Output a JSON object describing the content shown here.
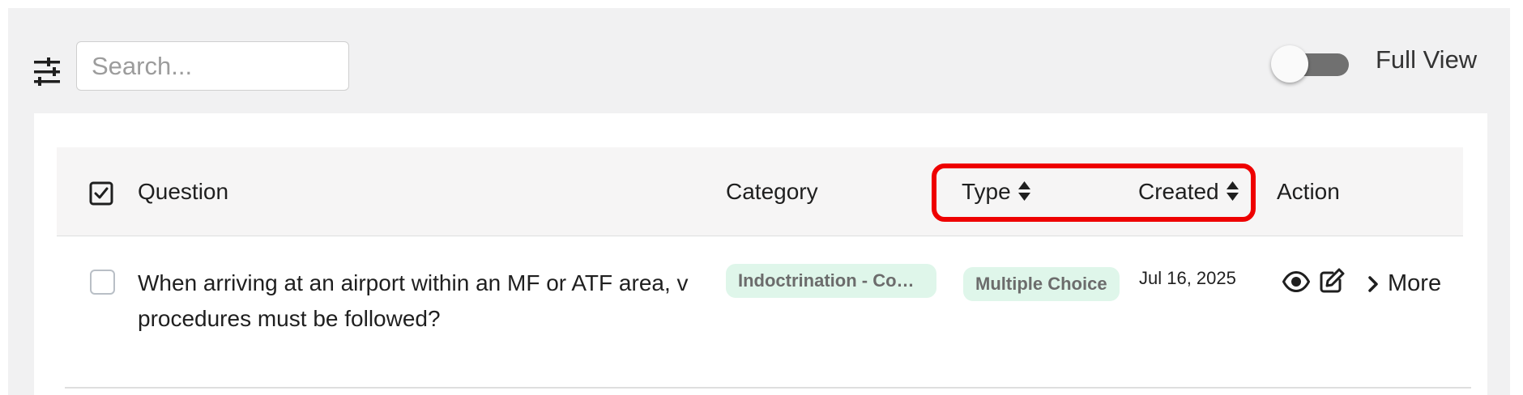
{
  "toolbar": {
    "filter_icon": "sliders-icon",
    "search_placeholder": "Search...",
    "full_view_label": "Full View",
    "full_view_enabled": false
  },
  "table": {
    "columns": [
      {
        "key": "select",
        "label": "",
        "icon": "checkbox-checked-icon"
      },
      {
        "key": "question",
        "label": "Question",
        "sortable": false
      },
      {
        "key": "category",
        "label": "Category",
        "sortable": false
      },
      {
        "key": "type",
        "label": "Type",
        "sortable": true
      },
      {
        "key": "created",
        "label": "Created",
        "sortable": true
      },
      {
        "key": "action",
        "label": "Action",
        "sortable": false
      }
    ],
    "rows": [
      {
        "checked": false,
        "question_lines": [
          "When arriving at an airport within an MF or ATF area, v",
          "procedures must be followed?"
        ],
        "category": "Indoctrination - Com...",
        "type": "Multiple Choice",
        "created": "Jul 16, 2025",
        "actions": {
          "view_icon": "eye-icon",
          "edit_icon": "edit-icon",
          "more_label": "More"
        }
      }
    ]
  },
  "colors": {
    "highlight": "#ee0000",
    "badge_bg": "#dff6ea",
    "badge_text": "#6c6c6c",
    "toggle_track": "#707070",
    "page_bg": "#f1f1f2"
  }
}
